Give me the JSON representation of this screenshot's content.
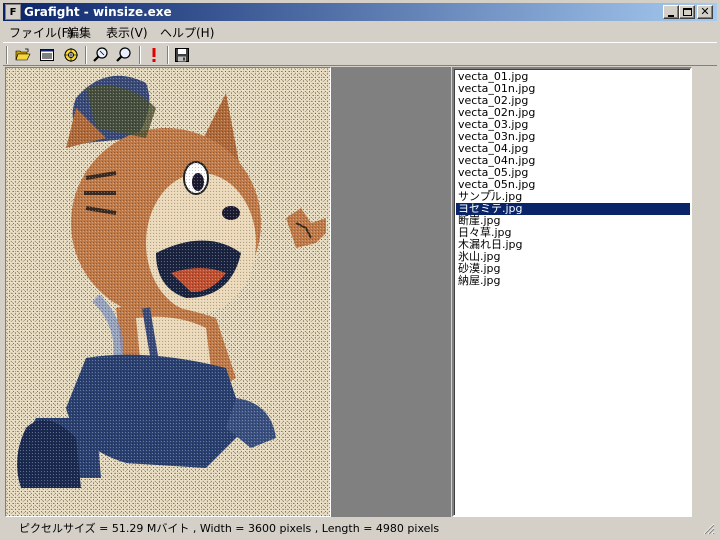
{
  "window": {
    "title": "Grafight - winsize.exe",
    "app_icon_glyph": "F"
  },
  "menu": {
    "items": [
      "ファイル(F)",
      "編集",
      "表示(V)",
      "ヘルプ(H)"
    ]
  },
  "toolbar": {
    "buttons": [
      "open-folder-icon",
      "list-view-icon",
      "target-icon",
      "zoom-in-icon",
      "zoom-out-icon",
      "alert-icon",
      "save-icon"
    ]
  },
  "files": {
    "items": [
      "vecta_01.jpg",
      "vecta_01n.jpg",
      "vecta_02.jpg",
      "vecta_02n.jpg",
      "vecta_03.jpg",
      "vecta_03n.jpg",
      "vecta_04.jpg",
      "vecta_04n.jpg",
      "vecta_05.jpg",
      "vecta_05n.jpg",
      "サンプル.jpg",
      "ヨセミテ.jpg",
      "断崖.jpg",
      "日々草.jpg",
      "木漏れ日.jpg",
      "氷山.jpg",
      "砂漠.jpg",
      "納屋.jpg"
    ],
    "selected_index": 11
  },
  "status": {
    "text": "ピクセルサイズ = 51.29 Mバイト , Width = 3600 pixels , Length = 4980 pixels"
  },
  "colors": {
    "title_start": "#0a246a",
    "title_end": "#a6caf0",
    "selection": "#0a246a",
    "chrome": "#d4d0c8"
  }
}
